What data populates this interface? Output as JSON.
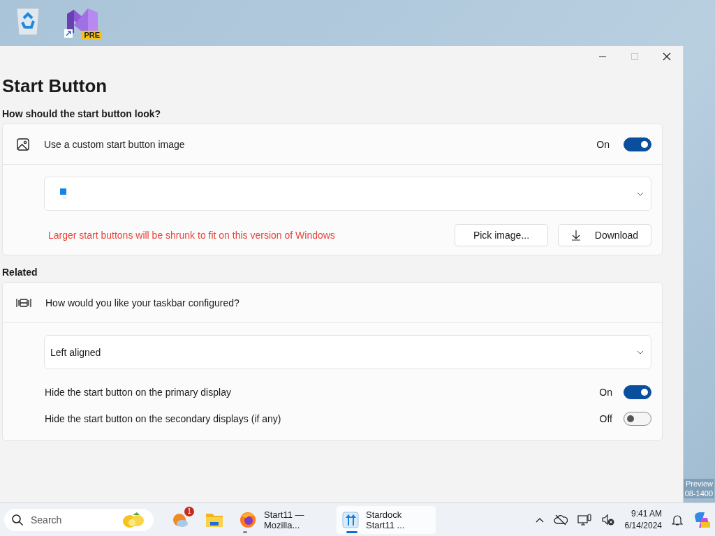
{
  "desktop": {
    "icons": [
      {
        "kind": "recycle"
      },
      {
        "kind": "studio",
        "badge": "PRE"
      }
    ],
    "watermark": [
      "Preview",
      "08-1400"
    ]
  },
  "window": {
    "controls": [
      {
        "kind": "minimize",
        "disabled": false
      },
      {
        "kind": "maximize",
        "disabled": true
      },
      {
        "kind": "close",
        "disabled": false
      }
    ],
    "title": "Start Button",
    "sections": [
      {
        "heading": "How should the start button look?",
        "card": {
          "label": "Use a custom start button image",
          "toggle": {
            "state_label": "On",
            "on": true
          },
          "dropdown": {
            "kind": "image"
          },
          "warning": "Larger start buttons will be shrunk to fit on this version of Windows",
          "buttons": [
            {
              "label": "Pick image...",
              "kind": "plain"
            },
            {
              "label": "Download",
              "kind": "download"
            }
          ]
        }
      },
      {
        "heading": "Related",
        "card": {
          "label": "How would you like your taskbar configured?",
          "dropdown": {
            "kind": "text",
            "value": "Left aligned"
          },
          "rows": [
            {
              "label": "Hide the start button on the primary display",
              "state_label": "On",
              "on": true
            },
            {
              "label": "Hide the start button on the secondary displays (if any)",
              "state_label": "Off",
              "on": false
            }
          ]
        }
      }
    ]
  },
  "taskbar": {
    "search": {
      "placeholder": "Search"
    },
    "apps": [
      {
        "kind": "weather",
        "badge": "1",
        "running": false,
        "selected": false
      },
      {
        "kind": "folder",
        "running": false,
        "selected": false
      },
      {
        "kind": "browser",
        "label": "Start11 — Mozilla...",
        "running": true,
        "selected": false
      },
      {
        "kind": "start11",
        "label": "Stardock Start11 ...",
        "running": true,
        "selected": true
      }
    ],
    "tray": {
      "time": "9:41 AM",
      "date": "6/14/2024"
    }
  }
}
